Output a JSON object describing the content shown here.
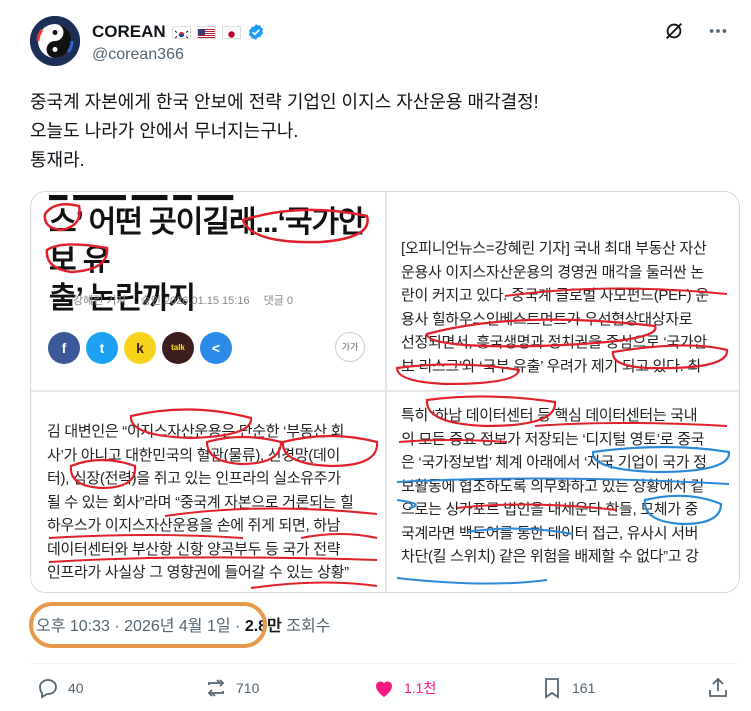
{
  "author": {
    "name": "COREAN",
    "handle": "@corean366",
    "flags": [
      "south-korea-flag",
      "usa-flag",
      "japan-flag"
    ]
  },
  "post": {
    "lines": [
      "중국계 자본에게 한국 안보에 전략 기업인 이지스 자산운용 매각결정!",
      "오늘도 나라가 안에서 무너지는구나.",
      "통재라."
    ]
  },
  "article": {
    "headline_line1": "스’ 어떤 곳이길래...‘국가안보 유",
    "headline_line2": "출’ 논란까지",
    "author_label": "강혜린 기자",
    "date_label": "승인 2026.01.15 15:16",
    "comments_label": "댓글 0",
    "font_button": "가가",
    "share_buttons": [
      "f",
      "t",
      "k",
      "talk",
      "<"
    ],
    "right_top": [
      "[오피니언뉴스=강혜린 기자] 국내 최대 부동산 자산",
      "운용사 이지스자산운용의 경영권 매각을 둘러싼 논",
      "란이 커지고 있다. 중국계 글로벌 사모펀드(PEF) 운",
      "용사 힐하우스인베스트먼트가 우선협상대상자로",
      "선정되면서, 흥국생명과 정치권을 중심으로 ‘국가안",
      "보 리스크’와 ‘국부 유출’ 우려가 제기 되고 있다. 최"
    ],
    "left_bottom": [
      "김 대변인은 “이지스자산운용은 단순한 ‘부동산 회",
      "사’가 아니고 대한민국의 혈관(물류), 신경망(데이",
      "터), 심장(전력)을 쥐고 있는 인프라의 실소유주가",
      "될 수 있는 회사”라며 “중국계 자본으로 거론되는 힐",
      "하우스가 이지스자산운용을 손에 쥐게 되면, 하남",
      "데이터센터와 부산항 신항 양곡부두 등 국가 전략",
      "인프라가 사실상 그 영향권에 들어갈 수 있는 상황”"
    ],
    "right_bottom": [
      "특히 ‘하남 데이터센터 등 핵심 데이터센터는 국내",
      "의 모든 중요 정보가 저장되는 ‘디지털 영토’로 중국",
      "은 ‘국가정보법’ 체계 아래에서 ‘자국 기업이 국가 정",
      "보활동에 협조하도록 의무화하고 있는 상황에서 겉",
      "으로는 싱가포르 법인을 내세운다 한들, 모체가 중",
      "국계라면 백도어를 통한 데이터 접근, 유사시 서버",
      "차단(킬 스위치) 같은 위험을 배제할 수 없다”고 강"
    ]
  },
  "meta": {
    "time": "오후 10:33 · 2026년 4월 1일 · ",
    "views_count": "2.8만",
    "views_label": " 조회수"
  },
  "actions": {
    "replies": "40",
    "reposts": "710",
    "likes": "1.1천",
    "bookmarks": "161"
  },
  "colors": {
    "like": "#f91880",
    "verified": "#1d9bf0",
    "annotation_oval": "#e6994a",
    "red_markup": "#e0202a",
    "blue_markup": "#2a8ad8"
  }
}
